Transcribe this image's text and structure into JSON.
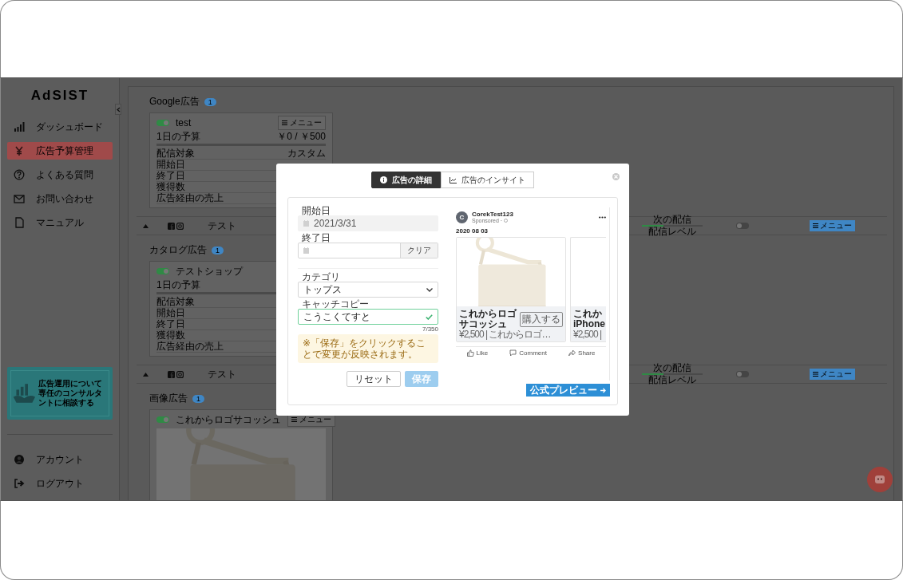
{
  "sidebar": {
    "logo": "AdSIST",
    "nav": [
      {
        "label": "ダッシュボード",
        "selected": false
      },
      {
        "label": "広告予算管理",
        "selected": true
      },
      {
        "label": "よくある質問",
        "selected": false
      },
      {
        "label": "お問い合わせ",
        "selected": false
      },
      {
        "label": "マニュアル",
        "selected": false
      }
    ],
    "banner": {
      "text": "広告運用について専任のコンサルタントに相談する"
    },
    "account_menu": [
      {
        "label": "アカウント"
      },
      {
        "label": "ログアウト"
      }
    ]
  },
  "main": [
    {
      "kind": "section",
      "title": "Google広告",
      "count": "1",
      "card": {
        "on": true,
        "name": "test",
        "menu": "メニュー",
        "budget_label": "1日の予算",
        "budget_value": "￥0 / ￥500",
        "level": 0,
        "rows": [
          {
            "label": "配信対象",
            "value": "カスタム"
          },
          {
            "label": "開始日"
          },
          {
            "label": "終了日"
          },
          {
            "label": "獲得数"
          },
          {
            "label": "広告経由の売上"
          }
        ]
      }
    },
    {
      "kind": "campaign_row",
      "name": "テスト",
      "status": "次の配信",
      "level": 0.35,
      "level_label": "配信レベル",
      "on": false,
      "menu": "メニュー"
    },
    {
      "kind": "section",
      "title": "カタログ広告",
      "count": "1",
      "card": {
        "on": true,
        "name": "テストショップ",
        "budget_label": "1日の予算",
        "level": 0,
        "rows": [
          {
            "label": "配信対象"
          },
          {
            "label": "開始日"
          },
          {
            "label": "終了日"
          },
          {
            "label": "獲得数"
          },
          {
            "label": "広告経由の売上"
          }
        ]
      }
    },
    {
      "kind": "campaign_row",
      "name": "テスト",
      "status": "次の配信",
      "level": 0.35,
      "level_label": "配信レベル",
      "on": false,
      "menu": "メニュー"
    },
    {
      "kind": "section",
      "title": "画像広告",
      "count": "1",
      "card": {
        "on": true,
        "name": "これからロゴサコッシュ",
        "menu": "メニュー"
      }
    }
  ],
  "modal": {
    "tabs": [
      {
        "label": "広告の詳細",
        "selected": true
      },
      {
        "label": "広告のインサイト",
        "selected": false
      }
    ],
    "form": {
      "fields": [
        {
          "kind": "date",
          "label": "開始日",
          "value": "2021/3/31",
          "disabled": true
        },
        {
          "kind": "date",
          "label": "終了日",
          "clear": "クリア",
          "disabled": false
        },
        {
          "kind": "select",
          "label": "カテゴリ",
          "value": "トップス"
        },
        {
          "kind": "text",
          "label": "キャッチコピー",
          "value": "こうこくてすと",
          "valid": true,
          "counter": "7/350"
        }
      ],
      "notice": "※「保存」をクリックすることで変更が反映されます。",
      "buttons": [
        {
          "label": "リセット",
          "kind": "secondary",
          "disabled": false
        },
        {
          "label": "保存",
          "kind": "primary",
          "disabled": true
        }
      ]
    },
    "preview": {
      "avatar": "C",
      "page_name": "CorekTest123",
      "sponsored": "Sponsored ·",
      "date": "2020 08 03",
      "cards": [
        {
          "title": "これからロゴサコッシュ",
          "cta": "購入する",
          "price": "¥2,500 | これからロゴ…"
        },
        {
          "title": "これか",
          "subtitle": "iPhone",
          "price": "¥2,500 |"
        }
      ],
      "actions": [
        {
          "label": "Like"
        },
        {
          "label": "Comment"
        },
        {
          "label": "Share"
        }
      ],
      "official_button": "公式プレビュー"
    }
  }
}
